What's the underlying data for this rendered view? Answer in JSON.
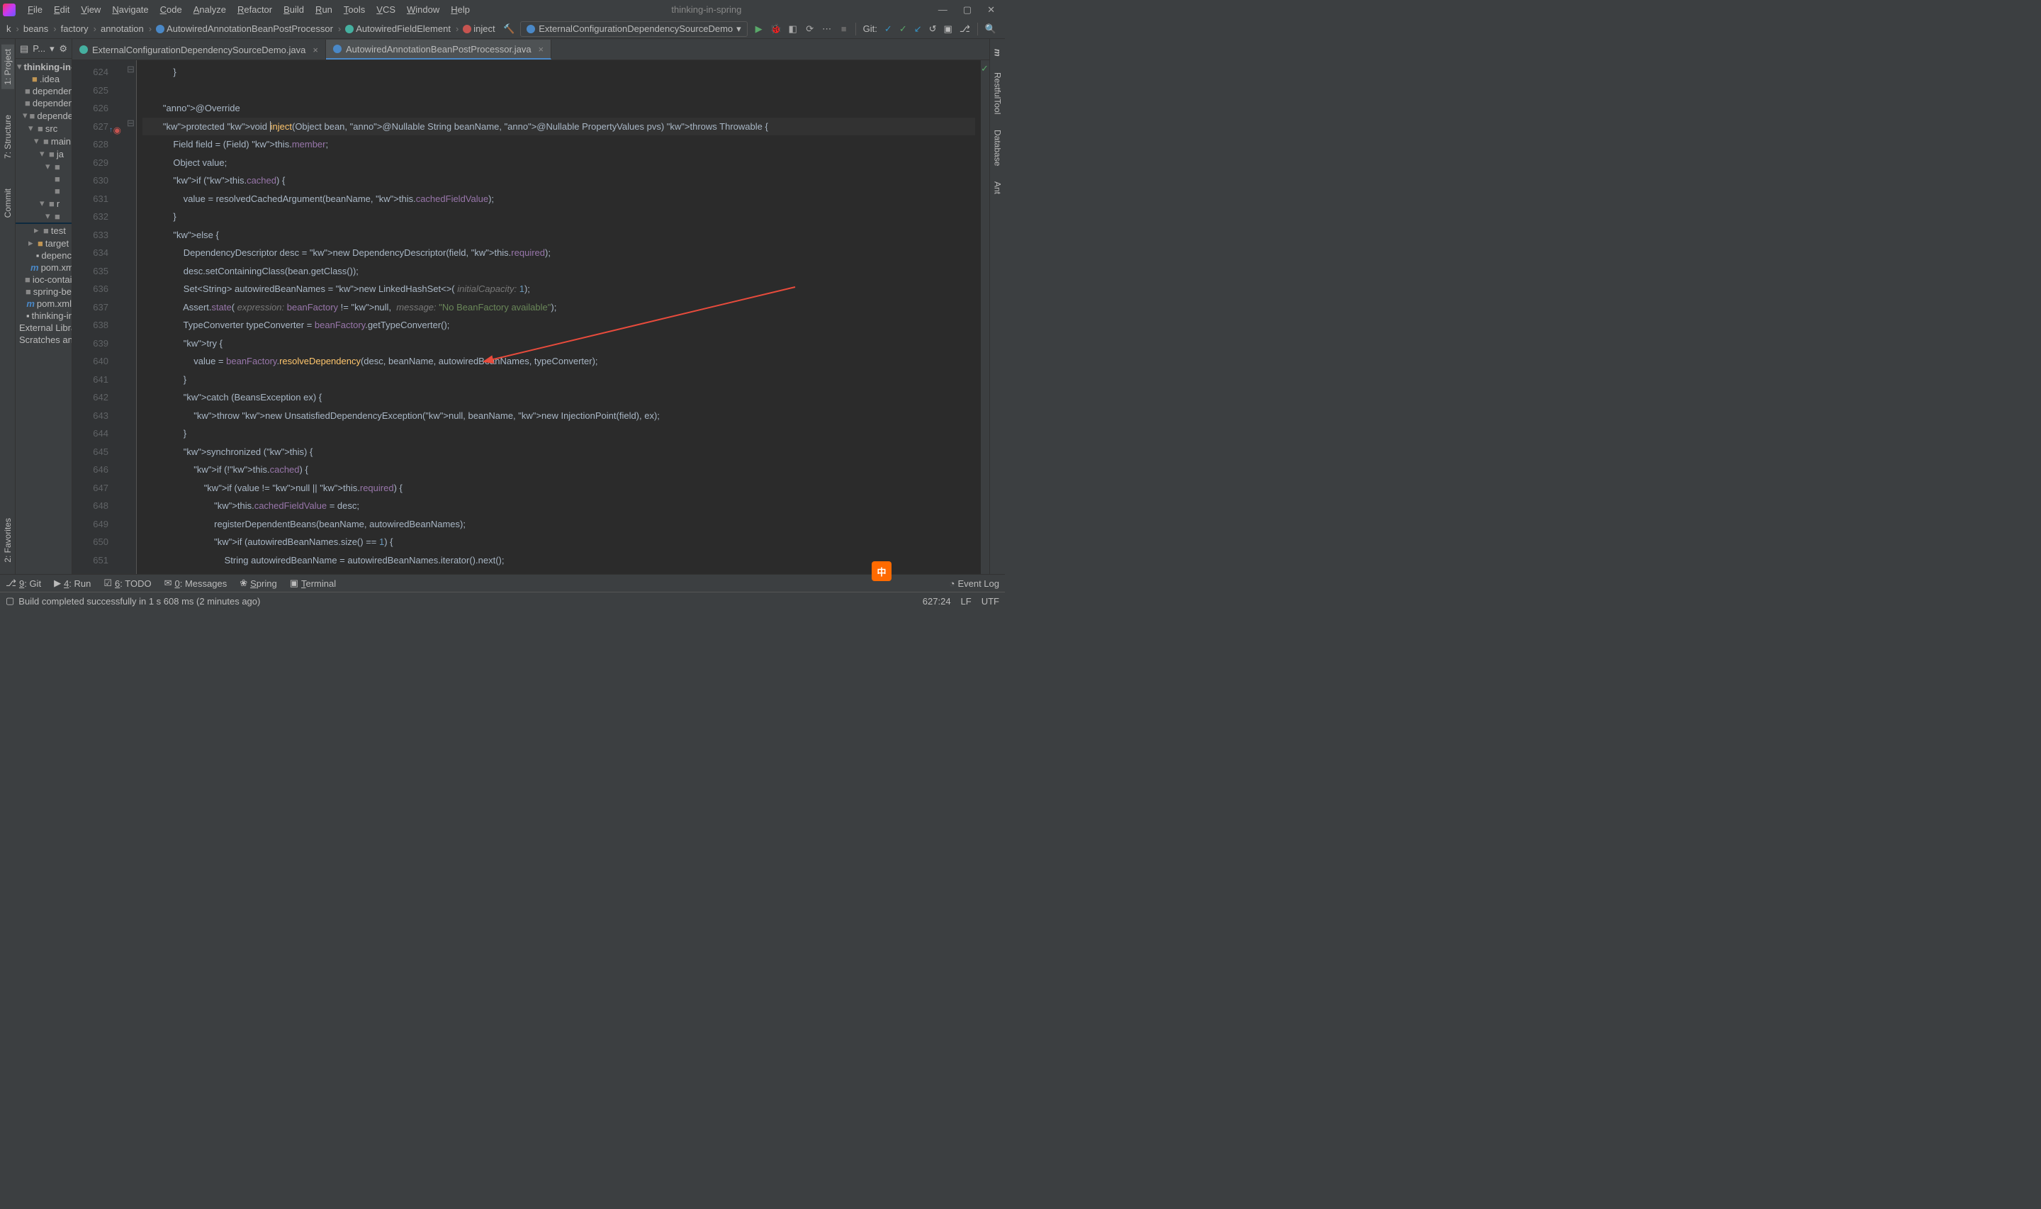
{
  "title": "thinking-in-spring",
  "menu": [
    "File",
    "Edit",
    "View",
    "Navigate",
    "Code",
    "Analyze",
    "Refactor",
    "Build",
    "Run",
    "Tools",
    "VCS",
    "Window",
    "Help"
  ],
  "breadcrumbs": [
    "k",
    "beans",
    "factory",
    "annotation",
    "AutowiredAnnotationBeanPostProcessor",
    "AutowiredFieldElement",
    "inject"
  ],
  "runConfig": "ExternalConfigurationDependencySourceDemo",
  "gitLabel": "Git:",
  "tabs": [
    {
      "name": "ExternalConfigurationDependencySourceDemo.java",
      "active": false,
      "color": "#45b0a0"
    },
    {
      "name": "AutowiredAnnotationBeanPostProcessor.java",
      "active": true,
      "color": "#4a88c7"
    }
  ],
  "projectHeader": "P...",
  "tree": [
    {
      "t": "thinking-in-s",
      "d": 0,
      "a": "▾",
      "bold": true
    },
    {
      "t": ".idea",
      "d": 1,
      "a": "",
      "f": "folder"
    },
    {
      "t": "dependen",
      "d": 1,
      "a": "",
      "f": "folder-g"
    },
    {
      "t": "dependen",
      "d": 1,
      "a": "",
      "f": "folder-g"
    },
    {
      "t": "dependen",
      "d": 1,
      "a": "▾",
      "f": "folder-g"
    },
    {
      "t": "src",
      "d": 2,
      "a": "▾",
      "f": "folder-g"
    },
    {
      "t": "main",
      "d": 3,
      "a": "▾",
      "f": "folder-g"
    },
    {
      "t": "ja",
      "d": 4,
      "a": "▾",
      "f": "folder-g"
    },
    {
      "t": "",
      "d": 5,
      "a": "▾",
      "f": "folder-g"
    },
    {
      "t": "",
      "d": 5,
      "a": "",
      "f": "folder-g"
    },
    {
      "t": "",
      "d": 5,
      "a": "",
      "f": "folder-g"
    },
    {
      "t": "r",
      "d": 4,
      "a": "▾",
      "f": "folder-g"
    },
    {
      "t": "",
      "d": 5,
      "a": "▾",
      "f": "folder-g"
    },
    {
      "t": "",
      "d": 5,
      "a": "",
      "sel": true
    },
    {
      "t": "test",
      "d": 3,
      "a": "▸",
      "f": "folder-g"
    },
    {
      "t": "target",
      "d": 2,
      "a": "▸",
      "f": "folder"
    },
    {
      "t": "depenc",
      "d": 2,
      "a": "",
      "f": "file"
    },
    {
      "t": "pom.xm",
      "d": 2,
      "a": "",
      "f": "file-m"
    },
    {
      "t": "ioc-contai",
      "d": 1,
      "a": "",
      "f": "folder-g"
    },
    {
      "t": "spring-be",
      "d": 1,
      "a": "",
      "f": "folder-g"
    },
    {
      "t": "pom.xml",
      "d": 1,
      "a": "",
      "f": "file-m"
    },
    {
      "t": "thinking-ir",
      "d": 1,
      "a": "",
      "f": "file"
    },
    {
      "t": "External Libra",
      "d": 0,
      "a": ""
    },
    {
      "t": "Scratches and",
      "d": 0,
      "a": ""
    }
  ],
  "gutter_start": 624,
  "gutter_end": 651,
  "code": [
    "            }",
    "",
    "        @Override",
    "        protected void inject(Object bean, @Nullable String beanName, @Nullable PropertyValues pvs) throws Throwable {",
    "            Field field = (Field) this.member;",
    "            Object value;",
    "            if (this.cached) {",
    "                value = resolvedCachedArgument(beanName, this.cachedFieldValue);",
    "            }",
    "            else {",
    "                DependencyDescriptor desc = new DependencyDescriptor(field, this.required);",
    "                desc.setContainingClass(bean.getClass());",
    "                Set<String> autowiredBeanNames = new LinkedHashSet<>( initialCapacity: 1);",
    "                Assert.state( expression: beanFactory != null,  message: \"No BeanFactory available\");",
    "                TypeConverter typeConverter = beanFactory.getTypeConverter();",
    "                try {",
    "                    value = beanFactory.resolveDependency(desc, beanName, autowiredBeanNames, typeConverter);",
    "                }",
    "                catch (BeansException ex) {",
    "                    throw new UnsatisfiedDependencyException(null, beanName, new InjectionPoint(field), ex);",
    "                }",
    "                synchronized (this) {",
    "                    if (!this.cached) {",
    "                        if (value != null || this.required) {",
    "                            this.cachedFieldValue = desc;",
    "                            registerDependentBeans(beanName, autowiredBeanNames);",
    "                            if (autowiredBeanNames.size() == 1) {",
    "                                String autowiredBeanName = autowiredBeanNames.iterator().next();"
  ],
  "leftTools": [
    "1: Project",
    "7: Structure",
    "Commit",
    "2: Favorites"
  ],
  "rightTools": [
    "m",
    "RestfulTool",
    "Database",
    "Ant"
  ],
  "bottomBar": [
    "9: Git",
    "4: Run",
    "6: TODO",
    "0: Messages",
    "Spring",
    "Terminal"
  ],
  "eventLog": "Event Log",
  "statusLeft": "Build completed successfully in 1 s 608 ms (2 minutes ago)",
  "statusRight": {
    "pos": "627:24",
    "lf": "LF",
    "enc": "UTF"
  },
  "imeBadge": "中"
}
